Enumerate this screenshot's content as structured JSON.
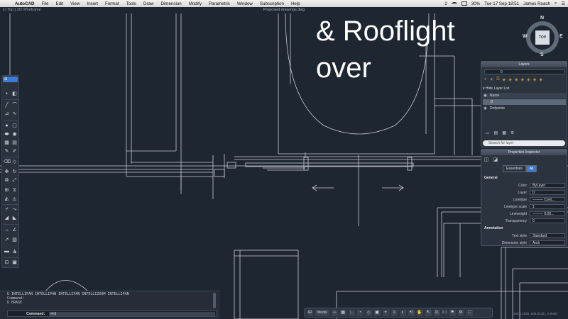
{
  "menubar": {
    "app": "AutoCAD",
    "items": [
      "File",
      "Edit",
      "View",
      "Insert",
      "Format",
      "Tools",
      "Draw",
      "Dimension",
      "Modify",
      "Parametric",
      "Window",
      "Subscription",
      "Help"
    ],
    "status_right": {
      "badge": "2",
      "battery": "30%",
      "clock": "Tue 17 Sep  18:51",
      "user": "James Roach"
    }
  },
  "window": {
    "doc_title": "Proposed drawings.dwg",
    "viewport_label": "[-] Top ] 2D Wireframe"
  },
  "overlay": {
    "line1": "& Rooflight",
    "line2": "over"
  },
  "viewcube": {
    "face": "TOP",
    "north": "N",
    "south": "S",
    "east": "E",
    "west": "W"
  },
  "layers_panel": {
    "title": "Layers",
    "current_layer": "0",
    "hide_list_label": "Hide Layer List",
    "column_name": "Name",
    "rows": [
      {
        "name": "0",
        "selected": true
      },
      {
        "name": "Defpoints",
        "selected": false
      }
    ],
    "search_placeholder": "Search for layer"
  },
  "properties_panel": {
    "title": "Properties Inspector",
    "tab_essentials": "Essentials",
    "tab_all": "All",
    "section_general": "General",
    "section_annotation": "Annotation",
    "props": [
      {
        "label": "Color",
        "value": "ByLayer"
      },
      {
        "label": "Layer",
        "value": "0"
      },
      {
        "label": "Linetype",
        "value": "——— Cont..."
      },
      {
        "label": "Linetype scale",
        "value": "1"
      },
      {
        "label": "Lineweight",
        "value": "——— 0.00..."
      },
      {
        "label": "Transparency",
        "value": "0"
      }
    ],
    "annotation_props": [
      {
        "label": "Text style",
        "value": "Standard"
      },
      {
        "label": "Dimension style",
        "value": "Arch"
      }
    ]
  },
  "command_line": {
    "history": [
      "U INTELLIPAN INTELLIPAN INTELLIPAN INTELLIZOOM INTELLIPAN",
      "Command:",
      "U ERASE"
    ],
    "label": "Command:",
    "value": "#n3"
  },
  "statusbar": {
    "model": "Model",
    "scale": "1:1",
    "coords": "-2918.1835, 848.0139 , 0.0000"
  },
  "colors": {
    "canvas": "#1e2632",
    "lines": "#c9ced6",
    "accent": "#3a7bd5"
  }
}
